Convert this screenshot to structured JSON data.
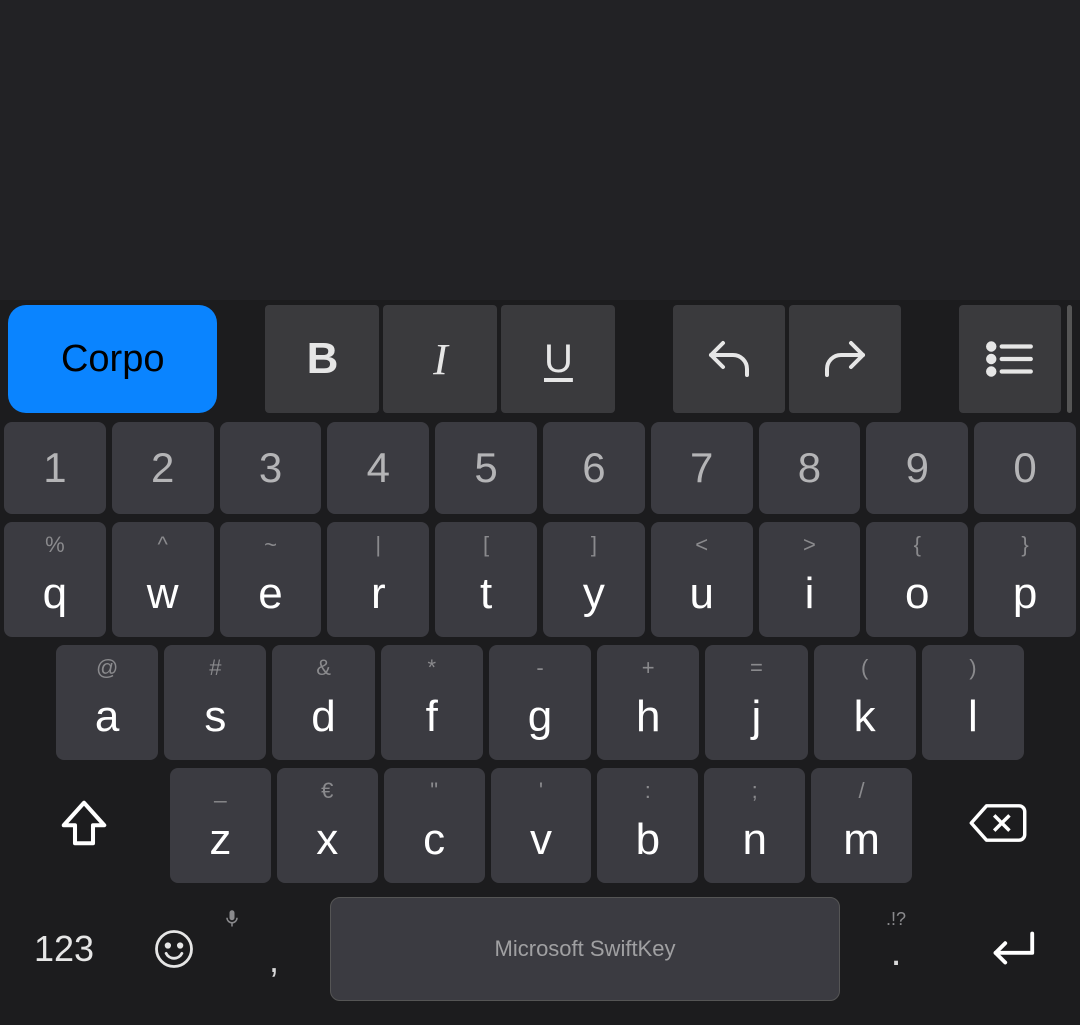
{
  "toolbar": {
    "style_label": "Corpo",
    "bold": "B",
    "italic": "I",
    "underline": "U"
  },
  "keyboard": {
    "numbers": [
      "1",
      "2",
      "3",
      "4",
      "5",
      "6",
      "7",
      "8",
      "9",
      "0"
    ],
    "row1": [
      {
        "main": "q",
        "sec": "%"
      },
      {
        "main": "w",
        "sec": "^"
      },
      {
        "main": "e",
        "sec": "~"
      },
      {
        "main": "r",
        "sec": "|"
      },
      {
        "main": "t",
        "sec": "["
      },
      {
        "main": "y",
        "sec": "]"
      },
      {
        "main": "u",
        "sec": "<"
      },
      {
        "main": "i",
        "sec": ">"
      },
      {
        "main": "o",
        "sec": "{"
      },
      {
        "main": "p",
        "sec": "}"
      }
    ],
    "row2": [
      {
        "main": "a",
        "sec": "@"
      },
      {
        "main": "s",
        "sec": "#"
      },
      {
        "main": "d",
        "sec": "&"
      },
      {
        "main": "f",
        "sec": "*"
      },
      {
        "main": "g",
        "sec": "-"
      },
      {
        "main": "h",
        "sec": "+"
      },
      {
        "main": "j",
        "sec": "="
      },
      {
        "main": "k",
        "sec": "("
      },
      {
        "main": "l",
        "sec": ")"
      }
    ],
    "row3": [
      {
        "main": "z",
        "sec": "_"
      },
      {
        "main": "x",
        "sec": "€"
      },
      {
        "main": "c",
        "sec": "\""
      },
      {
        "main": "v",
        "sec": "'"
      },
      {
        "main": "b",
        "sec": ":"
      },
      {
        "main": "n",
        "sec": ";"
      },
      {
        "main": "m",
        "sec": "/"
      }
    ],
    "symbols_key": "123",
    "comma": ",",
    "space_label": "Microsoft SwiftKey",
    "period": ".",
    "period_hint": ".!?",
    "mic_hint": "🎤"
  }
}
